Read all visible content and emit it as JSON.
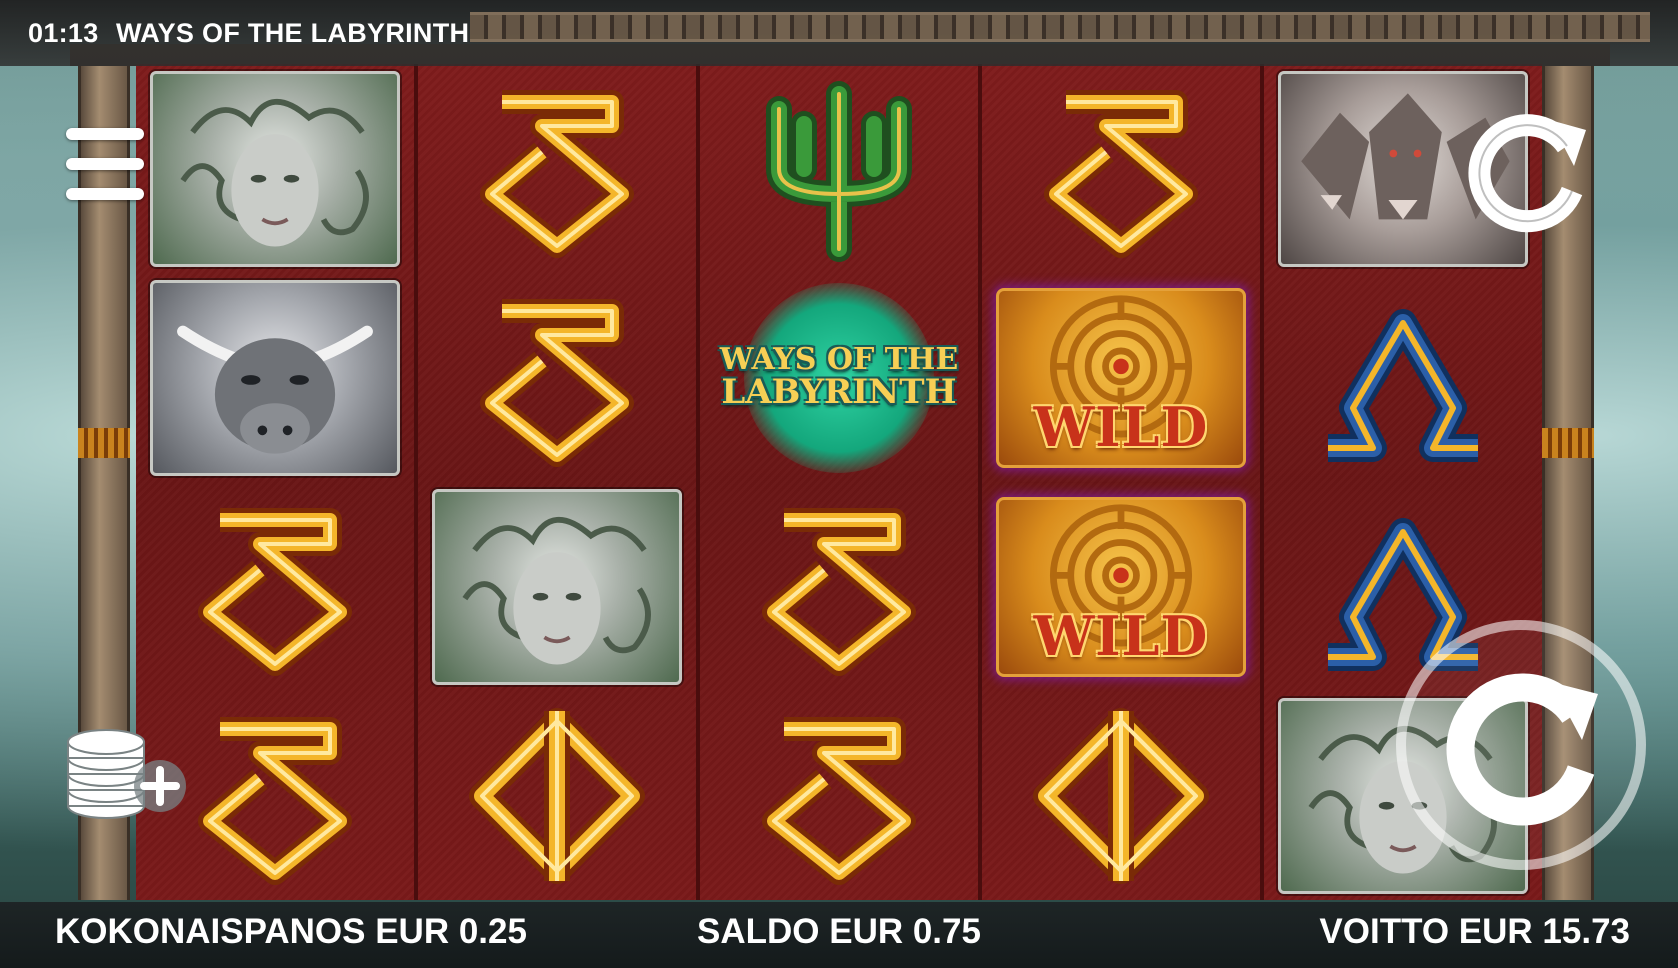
{
  "header": {
    "clock": "01:13",
    "game_title": "WAYS OF THE LABYRINTH"
  },
  "reels": [
    [
      "medusa",
      "minotaur",
      "delta",
      "delta"
    ],
    [
      "delta",
      "delta",
      "medusa",
      "phi"
    ],
    [
      "trident",
      "scatter-logo",
      "delta",
      "delta"
    ],
    [
      "delta",
      "wild",
      "wild",
      "phi"
    ],
    [
      "cerberus",
      "omega",
      "omega",
      "medusa"
    ]
  ],
  "symbols": {
    "wild_label": "WILD",
    "logo_line1": "WAYS OF THE",
    "logo_line2": "LABYRINTH"
  },
  "controls": {
    "menu_icon": "hamburger-menu-icon",
    "autoplay_icon": "replay-arrow-icon",
    "spin_icon": "spin-arrow-icon",
    "coins_icon": "coins-stack-plus-icon"
  },
  "footer": {
    "total_bet": "KOKONAISPANOS EUR 0.25",
    "balance": "SALDO EUR 0.75",
    "win": "VOITTO EUR 15.73"
  },
  "colors": {
    "reel_background": "#7f1c1c",
    "symbol_gold": "#f4b62a",
    "symbol_blue": "#2b5fa8",
    "trident_green": "#3a9a3a",
    "scatter_glow": "#2fd3a3",
    "wild_text": "#c8321a"
  }
}
